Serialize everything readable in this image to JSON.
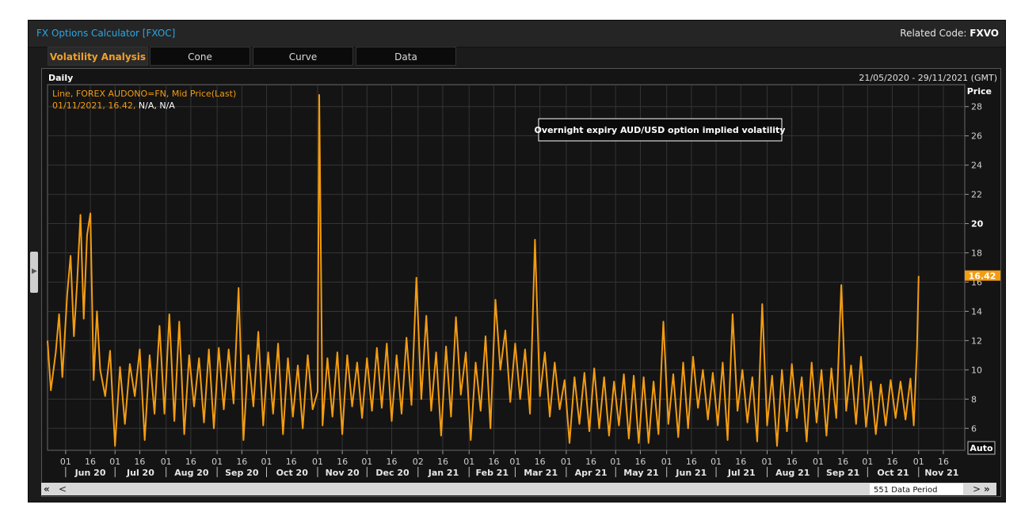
{
  "window": {
    "app_title": "FX Options Calculator [FXOC]",
    "related_label": "Related Code:",
    "related_code": "FXVO"
  },
  "tabs": [
    {
      "label": "Volatility Analysis",
      "active": true
    },
    {
      "label": "Cone",
      "active": false
    },
    {
      "label": "Curve",
      "active": false
    },
    {
      "label": "Data",
      "active": false
    }
  ],
  "panel": {
    "interval": "Daily",
    "date_range": "21/05/2020 - 29/11/2021 (GMT)",
    "legend_line1": "Line, FOREX AUDONO=FN, Mid Price(Last)",
    "legend_line2_orange": "01/11/2021, 16.42,",
    "legend_line2_white": "N/A, N/A",
    "annotation": "Overnight expiry AUD/USD option implied volatility",
    "price_label": "Price",
    "last_value_badge": "16.42",
    "auto_label": "Auto",
    "data_period": "551 Data Period",
    "nav_first": "«",
    "nav_prev": "<",
    "nav_next": ">",
    "nav_last": "»"
  },
  "colors": {
    "line": "#f39c12",
    "accent_title": "#2aa7e6",
    "badge": "#f39c12",
    "grid": "#353535",
    "background": "#141414"
  },
  "chart_data": {
    "type": "line",
    "series_name": "FOREX AUDONO=FN, Mid Price(Last)",
    "ylabel": "Price",
    "ylim": [
      4.5,
      29.5
    ],
    "yticks": [
      6,
      8,
      10,
      12,
      14,
      16,
      18,
      20,
      22,
      24,
      26,
      28
    ],
    "x_range": [
      "2020-05-21",
      "2021-11-29"
    ],
    "x_day_ticks": [
      "01",
      "16",
      "01",
      "16",
      "01",
      "16",
      "01",
      "16",
      "01",
      "16",
      "01",
      "16",
      "01",
      "16",
      "02",
      "16",
      "01",
      "16",
      "01",
      "16",
      "01",
      "16",
      "01",
      "16",
      "01",
      "16",
      "01",
      "16",
      "01",
      "16",
      "01",
      "16",
      "01",
      "16",
      "01",
      "16",
      "01",
      "16"
    ],
    "month_labels": [
      "Jun 20",
      "Jul 20",
      "Aug 20",
      "Sep 20",
      "Oct 20",
      "Nov 20",
      "Dec 20",
      "Jan 21",
      "Feb 21",
      "Mar 21",
      "Apr 21",
      "May 21",
      "Jun 21",
      "Jul 21",
      "Aug 21",
      "Sep 21",
      "Oct 21",
      "Nov 21"
    ],
    "points": [
      [
        "2020-05-21",
        12.0
      ],
      [
        "2020-05-23",
        8.6
      ],
      [
        "2020-05-26",
        11.2
      ],
      [
        "2020-05-28",
        13.8
      ],
      [
        "2020-05-30",
        9.5
      ],
      [
        "2020-06-02",
        15.2
      ],
      [
        "2020-06-04",
        17.8
      ],
      [
        "2020-06-06",
        12.3
      ],
      [
        "2020-06-08",
        16.0
      ],
      [
        "2020-06-10",
        20.6
      ],
      [
        "2020-06-12",
        13.5
      ],
      [
        "2020-06-14",
        19.2
      ],
      [
        "2020-06-16",
        20.7
      ],
      [
        "2020-06-18",
        9.3
      ],
      [
        "2020-06-20",
        14.0
      ],
      [
        "2020-06-22",
        10.0
      ],
      [
        "2020-06-25",
        8.2
      ],
      [
        "2020-06-28",
        11.3
      ],
      [
        "2020-07-01",
        4.8
      ],
      [
        "2020-07-04",
        10.2
      ],
      [
        "2020-07-07",
        6.3
      ],
      [
        "2020-07-10",
        10.4
      ],
      [
        "2020-07-13",
        8.2
      ],
      [
        "2020-07-16",
        11.4
      ],
      [
        "2020-07-19",
        5.2
      ],
      [
        "2020-07-22",
        11.0
      ],
      [
        "2020-07-25",
        7.0
      ],
      [
        "2020-07-28",
        13.0
      ],
      [
        "2020-07-31",
        7.0
      ],
      [
        "2020-08-03",
        13.8
      ],
      [
        "2020-08-06",
        6.5
      ],
      [
        "2020-08-09",
        13.3
      ],
      [
        "2020-08-12",
        5.6
      ],
      [
        "2020-08-15",
        11.0
      ],
      [
        "2020-08-18",
        7.5
      ],
      [
        "2020-08-21",
        10.8
      ],
      [
        "2020-08-24",
        6.4
      ],
      [
        "2020-08-27",
        11.4
      ],
      [
        "2020-08-30",
        6.0
      ],
      [
        "2020-09-02",
        11.5
      ],
      [
        "2020-09-05",
        7.3
      ],
      [
        "2020-09-08",
        11.4
      ],
      [
        "2020-09-11",
        7.7
      ],
      [
        "2020-09-14",
        15.6
      ],
      [
        "2020-09-17",
        5.2
      ],
      [
        "2020-09-20",
        11.0
      ],
      [
        "2020-09-23",
        7.5
      ],
      [
        "2020-09-26",
        12.6
      ],
      [
        "2020-09-29",
        6.2
      ],
      [
        "2020-10-02",
        11.2
      ],
      [
        "2020-10-05",
        7.0
      ],
      [
        "2020-10-08",
        11.8
      ],
      [
        "2020-10-11",
        5.6
      ],
      [
        "2020-10-14",
        10.8
      ],
      [
        "2020-10-17",
        6.8
      ],
      [
        "2020-10-20",
        10.3
      ],
      [
        "2020-10-23",
        6.0
      ],
      [
        "2020-10-26",
        11.0
      ],
      [
        "2020-10-29",
        7.3
      ],
      [
        "2020-11-01",
        8.5
      ],
      [
        "2020-11-02",
        28.8
      ],
      [
        "2020-11-03",
        18.0
      ],
      [
        "2020-11-04",
        6.2
      ],
      [
        "2020-11-07",
        10.8
      ],
      [
        "2020-11-10",
        6.8
      ],
      [
        "2020-11-13",
        11.2
      ],
      [
        "2020-11-16",
        5.6
      ],
      [
        "2020-11-19",
        11.0
      ],
      [
        "2020-11-22",
        7.5
      ],
      [
        "2020-11-25",
        10.5
      ],
      [
        "2020-11-28",
        6.7
      ],
      [
        "2020-12-01",
        10.8
      ],
      [
        "2020-12-04",
        7.2
      ],
      [
        "2020-12-07",
        11.5
      ],
      [
        "2020-12-10",
        7.4
      ],
      [
        "2020-12-13",
        11.8
      ],
      [
        "2020-12-16",
        6.5
      ],
      [
        "2020-12-19",
        11.0
      ],
      [
        "2020-12-22",
        7.0
      ],
      [
        "2020-12-25",
        12.2
      ],
      [
        "2020-12-28",
        7.6
      ],
      [
        "2020-12-31",
        16.3
      ],
      [
        "2021-01-03",
        8.0
      ],
      [
        "2021-01-06",
        13.7
      ],
      [
        "2021-01-09",
        7.2
      ],
      [
        "2021-01-12",
        11.2
      ],
      [
        "2021-01-15",
        5.5
      ],
      [
        "2021-01-18",
        11.6
      ],
      [
        "2021-01-21",
        6.8
      ],
      [
        "2021-01-24",
        13.6
      ],
      [
        "2021-01-27",
        8.3
      ],
      [
        "2021-01-30",
        11.2
      ],
      [
        "2021-02-02",
        5.2
      ],
      [
        "2021-02-05",
        10.5
      ],
      [
        "2021-02-08",
        7.2
      ],
      [
        "2021-02-11",
        12.3
      ],
      [
        "2021-02-14",
        6.0
      ],
      [
        "2021-02-17",
        14.8
      ],
      [
        "2021-02-20",
        10.0
      ],
      [
        "2021-02-23",
        12.7
      ],
      [
        "2021-02-26",
        7.8
      ],
      [
        "2021-03-01",
        11.8
      ],
      [
        "2021-03-04",
        8.0
      ],
      [
        "2021-03-07",
        11.4
      ],
      [
        "2021-03-10",
        7.0
      ],
      [
        "2021-03-13",
        18.9
      ],
      [
        "2021-03-16",
        8.2
      ],
      [
        "2021-03-19",
        11.2
      ],
      [
        "2021-03-22",
        6.8
      ],
      [
        "2021-03-25",
        10.5
      ],
      [
        "2021-03-28",
        7.3
      ],
      [
        "2021-03-31",
        9.3
      ],
      [
        "2021-04-03",
        5.0
      ],
      [
        "2021-04-06",
        9.5
      ],
      [
        "2021-04-09",
        6.3
      ],
      [
        "2021-04-12",
        9.8
      ],
      [
        "2021-04-15",
        5.8
      ],
      [
        "2021-04-18",
        10.1
      ],
      [
        "2021-04-21",
        6.0
      ],
      [
        "2021-04-24",
        9.5
      ],
      [
        "2021-04-27",
        5.5
      ],
      [
        "2021-04-30",
        9.2
      ],
      [
        "2021-05-03",
        6.2
      ],
      [
        "2021-05-06",
        9.7
      ],
      [
        "2021-05-09",
        5.3
      ],
      [
        "2021-05-12",
        9.6
      ],
      [
        "2021-05-15",
        5.0
      ],
      [
        "2021-05-18",
        9.5
      ],
      [
        "2021-05-21",
        5.0
      ],
      [
        "2021-05-24",
        9.2
      ],
      [
        "2021-05-27",
        5.6
      ],
      [
        "2021-05-30",
        13.3
      ],
      [
        "2021-06-02",
        6.3
      ],
      [
        "2021-06-05",
        9.7
      ],
      [
        "2021-06-08",
        5.4
      ],
      [
        "2021-06-11",
        10.5
      ],
      [
        "2021-06-14",
        6.0
      ],
      [
        "2021-06-17",
        10.9
      ],
      [
        "2021-06-20",
        7.4
      ],
      [
        "2021-06-23",
        10.0
      ],
      [
        "2021-06-26",
        6.6
      ],
      [
        "2021-06-29",
        9.8
      ],
      [
        "2021-07-02",
        6.2
      ],
      [
        "2021-07-05",
        10.5
      ],
      [
        "2021-07-08",
        5.2
      ],
      [
        "2021-07-11",
        13.8
      ],
      [
        "2021-07-14",
        7.2
      ],
      [
        "2021-07-17",
        10.0
      ],
      [
        "2021-07-20",
        6.4
      ],
      [
        "2021-07-23",
        9.5
      ],
      [
        "2021-07-26",
        5.1
      ],
      [
        "2021-07-29",
        14.5
      ],
      [
        "2021-08-01",
        6.2
      ],
      [
        "2021-08-04",
        9.6
      ],
      [
        "2021-08-07",
        4.8
      ],
      [
        "2021-08-10",
        10.0
      ],
      [
        "2021-08-13",
        5.8
      ],
      [
        "2021-08-16",
        10.4
      ],
      [
        "2021-08-19",
        6.7
      ],
      [
        "2021-08-22",
        9.5
      ],
      [
        "2021-08-25",
        5.1
      ],
      [
        "2021-08-28",
        10.5
      ],
      [
        "2021-08-31",
        6.4
      ],
      [
        "2021-09-03",
        10.0
      ],
      [
        "2021-09-06",
        5.5
      ],
      [
        "2021-09-09",
        10.1
      ],
      [
        "2021-09-12",
        6.7
      ],
      [
        "2021-09-15",
        15.8
      ],
      [
        "2021-09-18",
        7.2
      ],
      [
        "2021-09-21",
        10.3
      ],
      [
        "2021-09-24",
        6.3
      ],
      [
        "2021-09-27",
        10.9
      ],
      [
        "2021-09-30",
        6.1
      ],
      [
        "2021-10-03",
        9.2
      ],
      [
        "2021-10-06",
        5.6
      ],
      [
        "2021-10-09",
        9.0
      ],
      [
        "2021-10-12",
        6.2
      ],
      [
        "2021-10-15",
        9.3
      ],
      [
        "2021-10-18",
        6.7
      ],
      [
        "2021-10-21",
        9.2
      ],
      [
        "2021-10-24",
        6.6
      ],
      [
        "2021-10-27",
        9.4
      ],
      [
        "2021-10-29",
        6.2
      ],
      [
        "2021-10-31",
        11.5
      ],
      [
        "2021-11-01",
        16.42
      ]
    ]
  }
}
